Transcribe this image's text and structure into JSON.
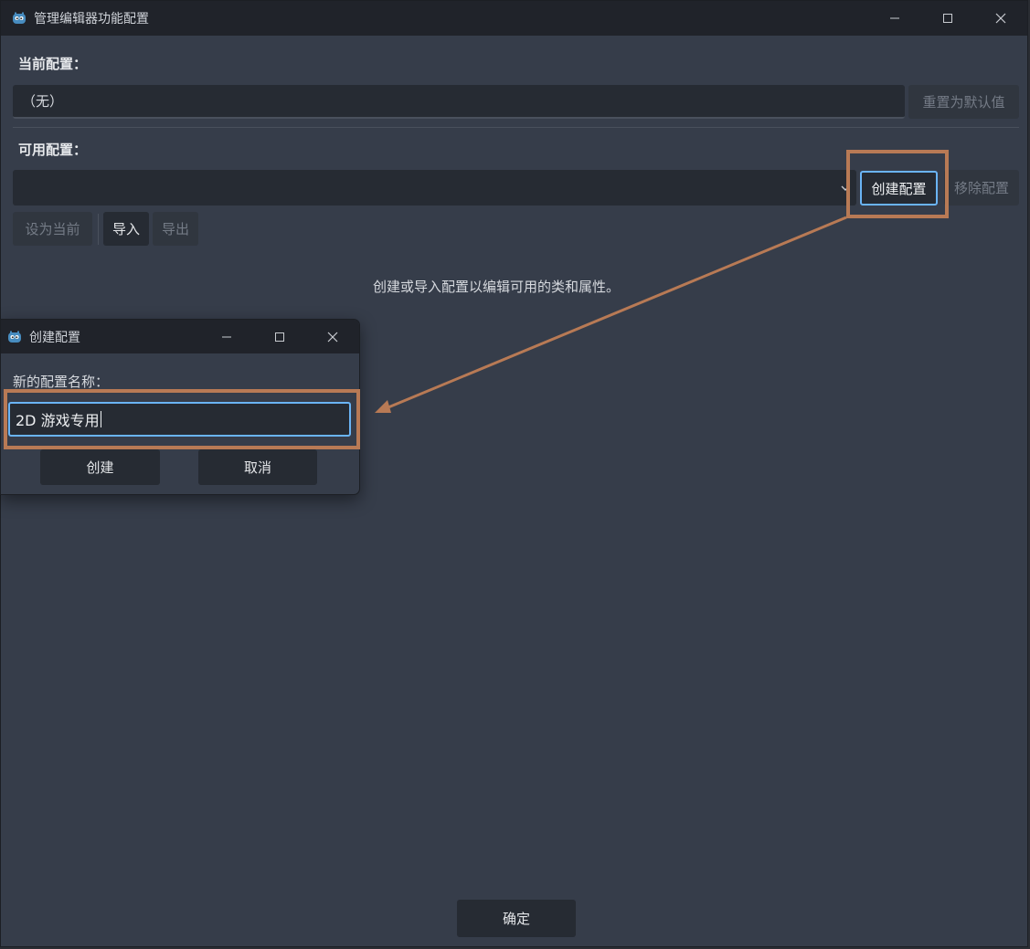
{
  "main_window": {
    "title": "管理编辑器功能配置",
    "current_profile_label": "当前配置：",
    "current_profile_value": "（无）",
    "reset_button": "重置为默认值",
    "available_profiles_label": "可用配置：",
    "profile_dropdown_value": "",
    "create_button": "创建配置",
    "remove_button": "移除配置",
    "set_current_button": "设为当前",
    "import_button": "导入",
    "export_button": "导出",
    "hint_text": "创建或导入配置以编辑可用的类和属性。",
    "ok_button": "确定"
  },
  "dialog": {
    "title": "创建配置",
    "name_label": "新的配置名称：",
    "name_value": "2D 游戏专用",
    "create_button": "创建",
    "cancel_button": "取消"
  },
  "colors": {
    "annotation": "#b87a55",
    "focus": "#6ab4f5",
    "panel_bg": "#363d4a",
    "titlebar_bg": "#20232a",
    "field_bg": "#262b33"
  },
  "icons": {
    "app": "godot-icon",
    "minimize": "minimize-icon",
    "maximize": "maximize-icon",
    "close": "close-icon",
    "dropdown": "chevron-down-icon"
  }
}
